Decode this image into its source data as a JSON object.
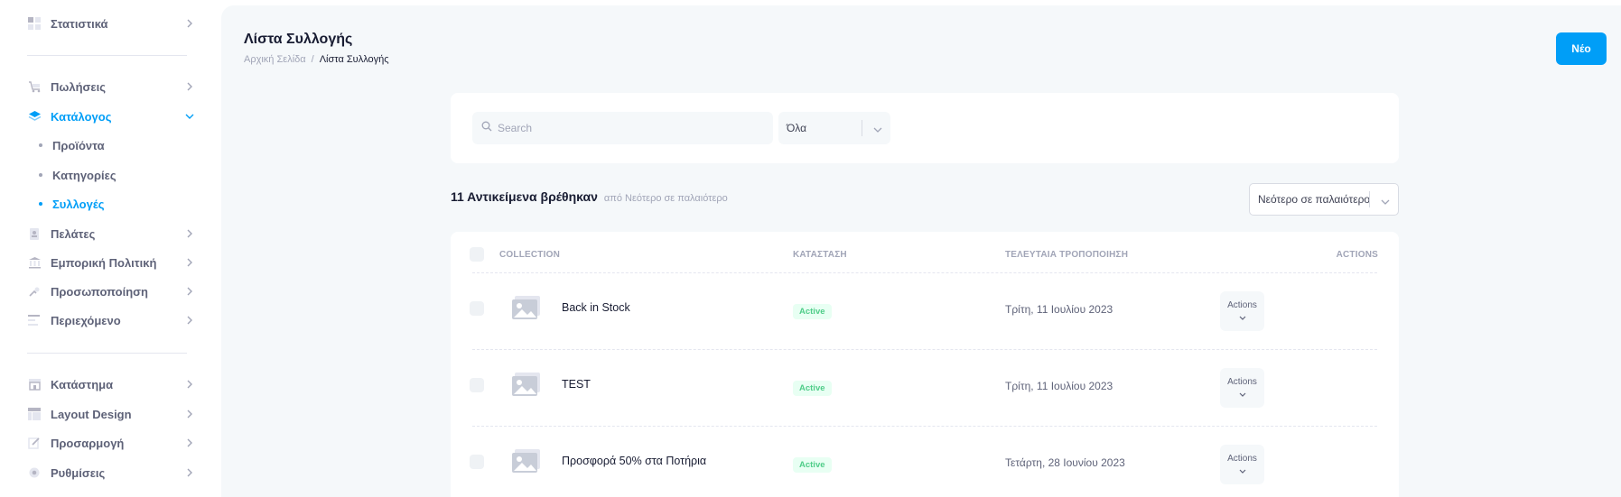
{
  "sidebar": {
    "items": [
      {
        "label": "Στατιστικά",
        "icon": "stats-icon"
      },
      {
        "label": "Πωλήσεις",
        "icon": "cart-icon"
      },
      {
        "label": "Κατάλογος",
        "icon": "layers-icon"
      },
      {
        "label": "Πελάτες",
        "icon": "address-book-icon"
      },
      {
        "label": "Εμπορική Πολιτική",
        "icon": "bank-icon"
      },
      {
        "label": "Προσωποποίηση",
        "icon": "user-personalize-icon"
      },
      {
        "label": "Περιεχόμενο",
        "icon": "text-lines-icon"
      },
      {
        "label": "Κατάστημα",
        "icon": "store-icon"
      },
      {
        "label": "Layout Design",
        "icon": "layout-icon"
      },
      {
        "label": "Προσαρμογή",
        "icon": "pencil-icon"
      },
      {
        "label": "Ρυθμίσεις",
        "icon": "gear-icon"
      }
    ],
    "catalog_sub": [
      {
        "label": "Προϊόντα"
      },
      {
        "label": "Κατηγορίες"
      },
      {
        "label": "Συλλογές"
      }
    ]
  },
  "header": {
    "title": "Λίστα Συλλογής",
    "breadcrumb": [
      "Αρχική Σελίδα",
      "/",
      "Λίστα Συλλογής"
    ],
    "new_label": "Νέο"
  },
  "filters": {
    "search_placeholder": "Search",
    "status_value": "Όλα"
  },
  "results": {
    "count_label": "11 Αντικείμενα βρέθηκαν",
    "sort_hint": "από Νεότερο σε παλαιότερο",
    "sort_value": "Νεότερο σε παλαιότερο"
  },
  "table": {
    "headers": [
      "COLLECTION",
      "ΚΑΤΑΣΤΑΣΗ",
      "ΤΕΛΕΥΤΑΙΑ ΤΡΟΠΟΠΟΙΗΣΗ",
      "ACTIONS"
    ],
    "rows": [
      {
        "name": "Back in Stock",
        "status": "Active",
        "modified": "Τρίτη, 11 Ιουλίου 2023",
        "action": "Actions"
      },
      {
        "name": "TEST",
        "status": "Active",
        "modified": "Τρίτη, 11 Ιουλίου 2023",
        "action": "Actions"
      },
      {
        "name": "Προσφορά 50% στα Ποτήρια",
        "status": "Active",
        "modified": "Τετάρτη, 28 Ιουνίου 2023",
        "action": "Actions"
      }
    ]
  },
  "colors": {
    "accent": "#009ef7",
    "success": "#50cd89",
    "background": "#f5f8fa"
  }
}
